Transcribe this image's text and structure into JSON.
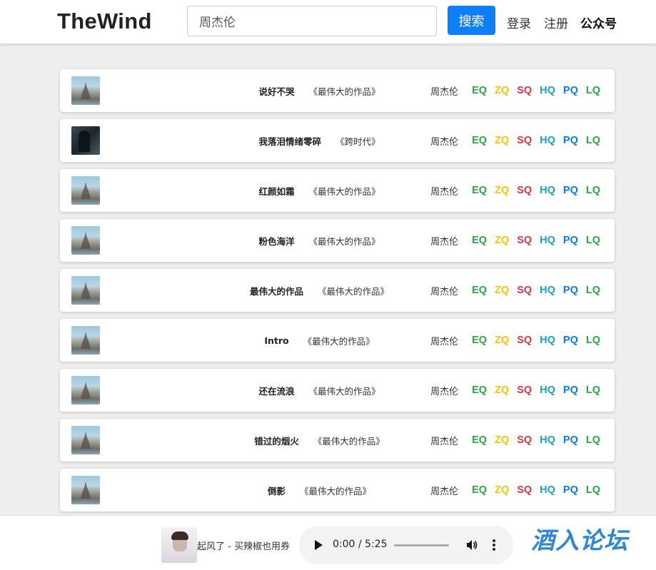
{
  "header": {
    "logo": "TheWind",
    "search_value": "周杰伦",
    "search_button": "搜索",
    "login": "登录",
    "register": "注册",
    "wechat": "公众号"
  },
  "quality_colors": {
    "EQ": "#28a745",
    "ZQ": "#ffc107",
    "SQ": "#dc3545",
    "HQ": "#17a2b8",
    "PQ": "#007bff",
    "LQ": "#28a745"
  },
  "songs": [
    {
      "title": "说好不哭",
      "album": "《最伟大的作品》",
      "artist": "周杰伦",
      "cover": "castle"
    },
    {
      "title": "我落泪情绪零碎",
      "album": "《跨时代》",
      "artist": "周杰伦",
      "cover": "dark"
    },
    {
      "title": "红颜如霜",
      "album": "《最伟大的作品》",
      "artist": "周杰伦",
      "cover": "castle"
    },
    {
      "title": "粉色海洋",
      "album": "《最伟大的作品》",
      "artist": "周杰伦",
      "cover": "castle"
    },
    {
      "title": "最伟大的作品",
      "album": "《最伟大的作品》",
      "artist": "周杰伦",
      "cover": "castle"
    },
    {
      "title": "Intro",
      "album": "《最伟大的作品》",
      "artist": "周杰伦",
      "cover": "castle"
    },
    {
      "title": "还在流浪",
      "album": "《最伟大的作品》",
      "artist": "周杰伦",
      "cover": "castle"
    },
    {
      "title": "错过的烟火",
      "album": "《最伟大的作品》",
      "artist": "周杰伦",
      "cover": "castle"
    },
    {
      "title": "倒影",
      "album": "《最伟大的作品》",
      "artist": "周杰伦",
      "cover": "castle"
    }
  ],
  "qualities": [
    "EQ",
    "ZQ",
    "SQ",
    "HQ",
    "PQ",
    "LQ"
  ],
  "player": {
    "track": "起风了 - 买辣椒也用券",
    "time": "0:00 / 5:25",
    "progress": 0
  },
  "watermark": "酒入论坛"
}
